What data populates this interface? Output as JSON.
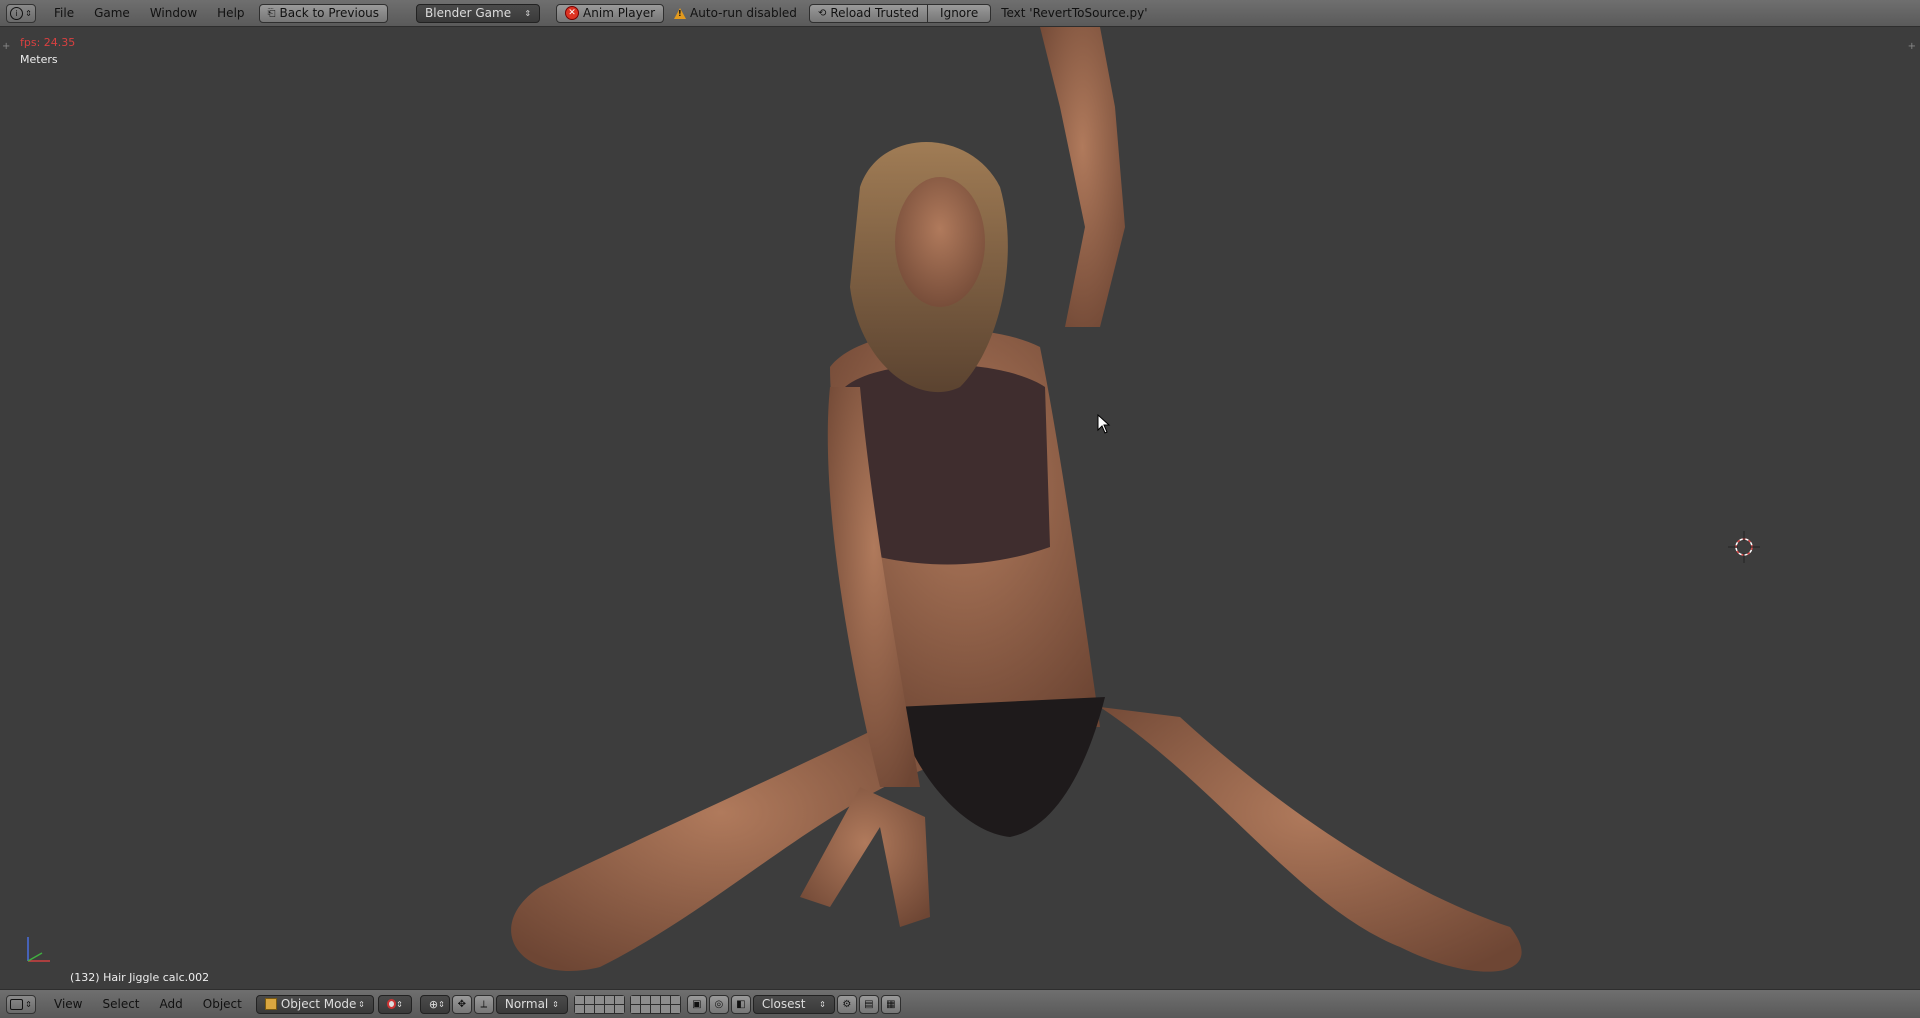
{
  "top_header": {
    "menus": [
      "File",
      "Game",
      "Window",
      "Help"
    ],
    "back_button": "Back to Previous",
    "engine_select": "Blender Game",
    "script_button": "Anim Player",
    "autorun_warning": "Auto-run disabled",
    "reload_trusted": "Reload Trusted",
    "ignore": "Ignore",
    "text_status": "Text 'RevertToSource.py'"
  },
  "viewport": {
    "fps": "fps: 24.35",
    "units": "Meters",
    "object_info": "(132) Hair Jiggle calc.002"
  },
  "bottom_header": {
    "menus": [
      "View",
      "Select",
      "Add",
      "Object"
    ],
    "mode_select": "Object Mode",
    "orientation_select": "Normal",
    "snap_target_select": "Closest"
  },
  "colors": {
    "header_bg": "#666666",
    "viewport_bg": "#3d3d3d",
    "fps_text": "#d94040",
    "warning": "#e39a1e",
    "close_red": "#dd3322"
  },
  "icons": [
    "info-editor-icon",
    "back-icon",
    "close-circle-icon",
    "warning-icon",
    "reload-icon",
    "view3d-editor-icon",
    "cube-mode-icon",
    "shading-icon",
    "pivot-icon",
    "manipulator-icon",
    "orientation-icon",
    "snap-icon",
    "render-icon",
    "camera-icon"
  ]
}
